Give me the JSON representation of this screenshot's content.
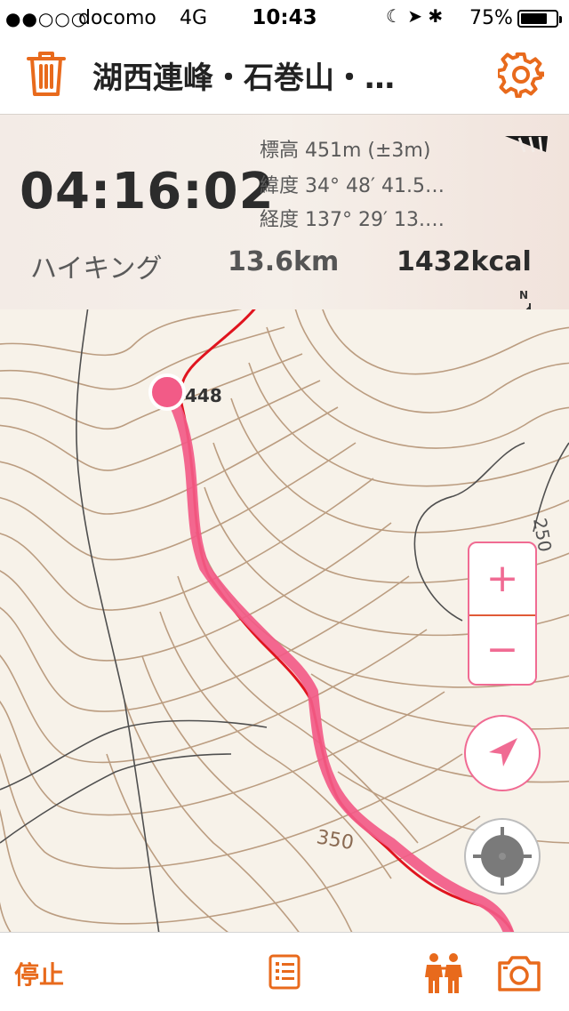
{
  "status_bar": {
    "signal": "●●○○○",
    "carrier": "docomo",
    "network": "4G",
    "time": "10:43",
    "icons": "☾ ➤ ✱",
    "battery_percent": "75%",
    "battery_level": 0.75
  },
  "nav": {
    "title": "湖西連峰・石巻山・…",
    "trash_icon": "trash-icon",
    "settings_icon": "gear-icon"
  },
  "info": {
    "elapsed": "04:16:02",
    "altitude": "標高 451m (±3m)",
    "latitude": "緯度 34° 48′ 41.5…",
    "longitude": "経度 137° 29′ 13.…",
    "mode": "ハイキング",
    "distance": "13.6km",
    "calories": "1432kcal",
    "compass_label": "N"
  },
  "map": {
    "labels": [
      "448",
      "250",
      "350"
    ],
    "track_color": "#f25b87",
    "route_color": "#e0141e"
  },
  "controls": {
    "zoom_in": "+",
    "zoom_out": "−",
    "locate_icon": "navigation-arrow-icon",
    "gps_icon": "gps-target-icon"
  },
  "tabbar": {
    "stop_label": "停止",
    "list_icon": "list-icon",
    "people_icon": "people-icon",
    "camera_icon": "camera-icon"
  },
  "colors": {
    "accent": "#e86a1c",
    "pink": "#f06b93",
    "info_bg": "#f3ebe6"
  }
}
